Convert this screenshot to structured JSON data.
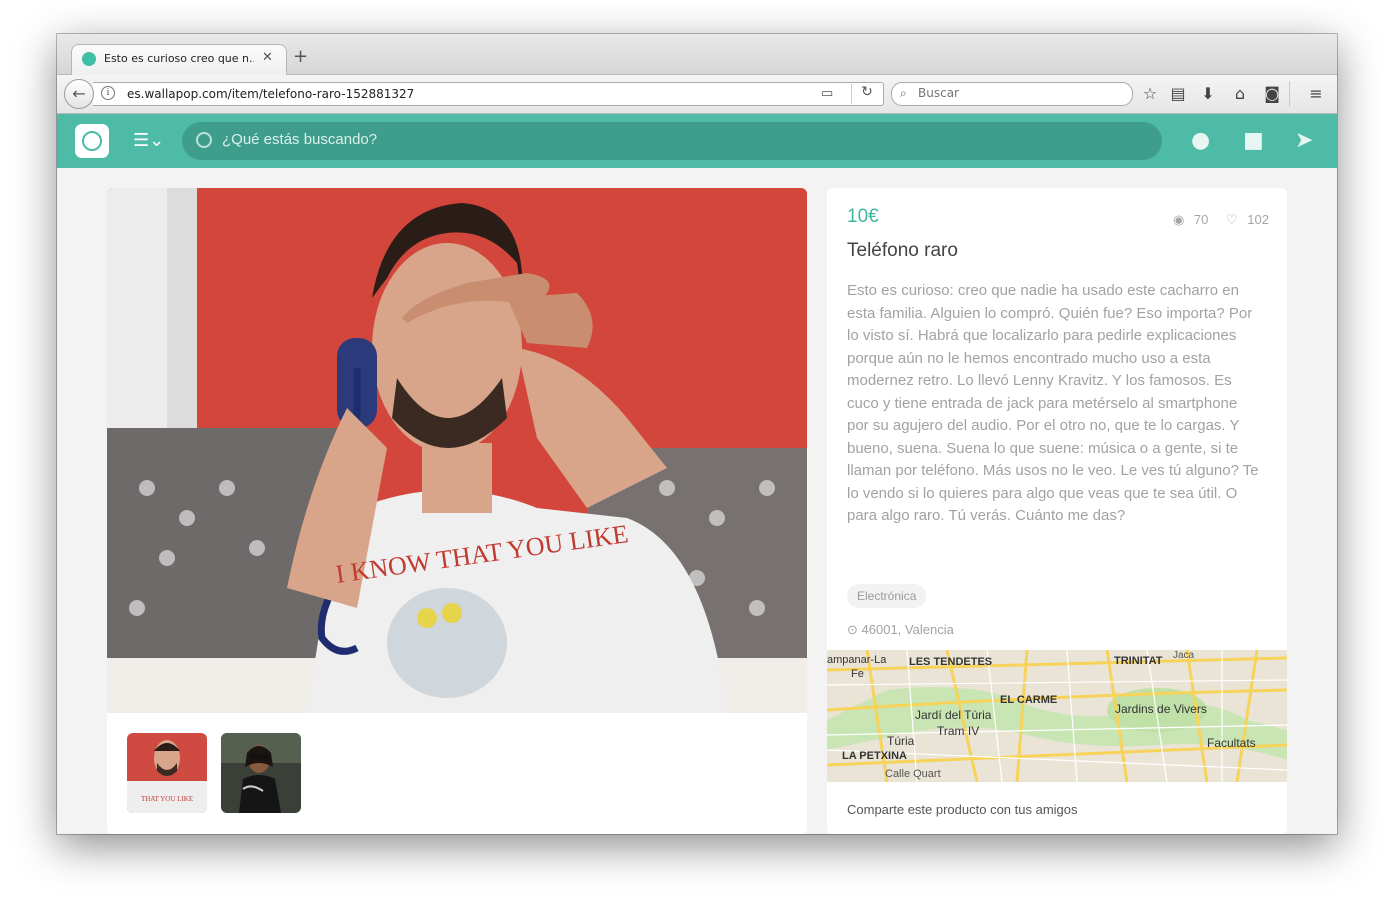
{
  "browser": {
    "tab_title": "Esto es curioso creo que n...",
    "tab_close": "✕",
    "new_tab": "+",
    "url": "es.wallapop.com/item/telefono-raro-152881327",
    "search_placeholder": "Buscar"
  },
  "header": {
    "search_placeholder": "¿Qué estás buscando?",
    "accent_color": "#4dbba5"
  },
  "item": {
    "price": "10€",
    "views": "70",
    "likes": "102",
    "title": "Teléfono raro",
    "description": "Esto es curioso: creo que nadie ha usado este cacharro en esta familia. Alguien lo compró. Quién fue? Eso importa? Por lo visto sí. Habrá que localizarlo para pedirle explicaciones porque aún no le hemos encontrado mucho uso a esta modernez retro. Lo llevó Lenny Kravitz. Y los famosos. Es cuco y tiene entrada de jack para metérselo al smartphone por su agujero del audio. Por el otro no, que te lo cargas. Y bueno, suena. Suena lo que suene: música o a gente, si te llaman por teléfono. Más usos no le veo. Le ves tú alguno? Te lo vendo si lo quieres para algo que veas que te sea útil. O para algo raro. Tú verás. Cuánto me das?",
    "category": "Electrónica",
    "location": "46001, Valencia",
    "share_text": "Comparte este producto con tus amigos"
  },
  "map": {
    "labels": {
      "campanar": "ampanar-La",
      "campanar2": "Fe",
      "tendetes": "LES TENDETES",
      "trinitat": "TRINITAT",
      "carme": "EL CARME",
      "turia_garden": "Jardí del Túria",
      "tram": "Tram IV",
      "turia": "Túria",
      "vivers": "Jardins de Vivers",
      "petxina": "LA PETXINA",
      "facultats": "Facultats",
      "quart": "Calle Quart",
      "jaca": "Jaca"
    }
  }
}
